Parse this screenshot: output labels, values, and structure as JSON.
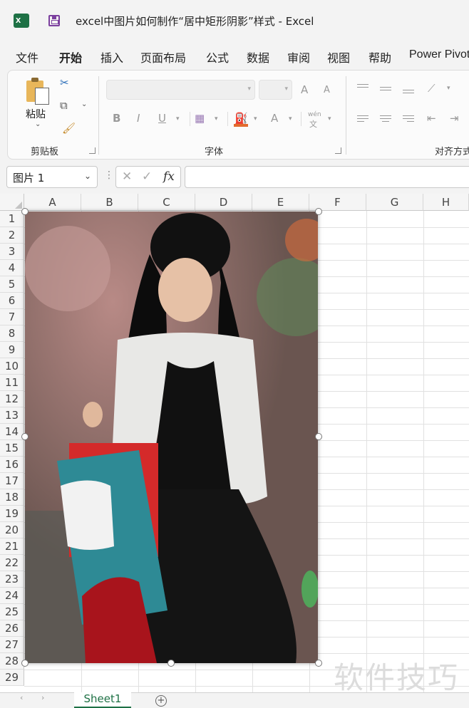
{
  "window": {
    "title": "excel中图片如何制作“居中矩形阴影”样式  -  Excel"
  },
  "menu": {
    "tabs": [
      {
        "label": "文件"
      },
      {
        "label": "开始"
      },
      {
        "label": "插入"
      },
      {
        "label": "页面布局"
      },
      {
        "label": "公式"
      },
      {
        "label": "数据"
      },
      {
        "label": "审阅"
      },
      {
        "label": "视图"
      },
      {
        "label": "帮助"
      },
      {
        "label": "Power Pivot"
      }
    ],
    "active": "开始"
  },
  "ribbon": {
    "clipboard": {
      "paste_label": "粘贴",
      "group_label": "剪贴板"
    },
    "font": {
      "group_label": "字体",
      "grow_label": "A",
      "shrink_label": "A",
      "bold": "B",
      "italic": "I",
      "underline": "U",
      "font_color": "A",
      "wen_top": "wén",
      "wen_bottom": "文"
    },
    "alignment": {
      "group_label": "对齐方式"
    }
  },
  "formula_bar": {
    "name_box": "图片 1",
    "fx_label": "fx",
    "formula_value": ""
  },
  "grid": {
    "columns": [
      "A",
      "B",
      "C",
      "D",
      "E",
      "F",
      "G",
      "H"
    ],
    "rows": [
      "1",
      "2",
      "3",
      "4",
      "5",
      "6",
      "7",
      "8",
      "9",
      "10",
      "11",
      "12",
      "13",
      "14",
      "15",
      "16",
      "17",
      "18",
      "19",
      "20",
      "21",
      "22",
      "23",
      "24",
      "25",
      "26",
      "27",
      "28",
      "29"
    ]
  },
  "watermark": "软件技巧",
  "sheets": {
    "tabs": [
      {
        "label": "Sheet1"
      }
    ],
    "add_label": "+"
  },
  "colors": {
    "accent": "#1e7145",
    "fill_color_bar": "#e26b2e",
    "save_icon": "#7b3f9e"
  }
}
